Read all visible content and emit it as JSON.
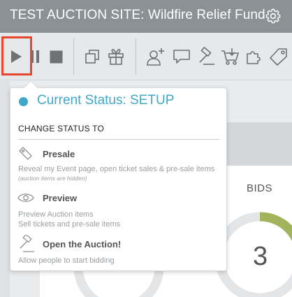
{
  "app": {
    "title": "TEST AUCTION SITE: Wildfire Relief Fund"
  },
  "toolbar": {
    "icons": [
      "play-icon",
      "pause-icon",
      "stop-icon",
      "copy-icon",
      "gift-icon",
      "add-user-icon",
      "chat-icon",
      "auction-gavel-icon",
      "cart-icon",
      "puzzle-icon",
      "tag-icon"
    ]
  },
  "colors": {
    "accent": "#3fa7c9",
    "highlight": "#e8472f",
    "progress": "#a2b45b"
  },
  "popover": {
    "status_label": "Current Status: SETUP",
    "change_heading": "CHANGE STATUS TO",
    "options": [
      {
        "label": "Presale",
        "desc1": "Reveal my Event page, open ticket sales & pre-sale items",
        "note": "(auction items are hidden)",
        "icon": "tag-icon"
      },
      {
        "label": "Preview",
        "desc1": "Preview Auction items",
        "desc2": "Sell tickets and pre-sale items",
        "icon": "eye-icon"
      },
      {
        "label": "Open the Auction!",
        "desc1": "Allow people to start bidding",
        "icon": "gavel-icon"
      }
    ]
  },
  "dashboard": {
    "bids_label": "BIDS",
    "bids_count": "3"
  }
}
